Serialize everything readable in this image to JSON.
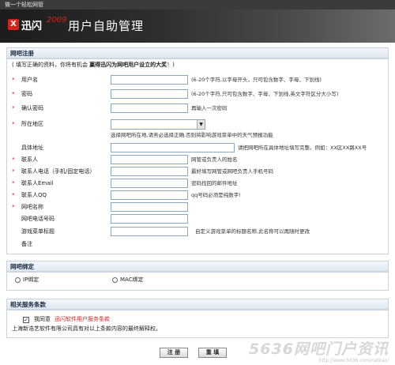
{
  "window": {
    "top_title": "做一个轻松网管"
  },
  "brand": {
    "logo_icon": "X",
    "logo_text": "迅闪",
    "logo_num": "2009",
    "page_title": "用户自助管理"
  },
  "register": {
    "header": "网吧注册",
    "notice_pre": "( 填写正确的资料，你将有机会 ",
    "notice_bold": "赢得迅闪为网吧用户设立的大奖",
    "notice_post": "！)",
    "fields": [
      {
        "required": true,
        "label": "用户名",
        "hint": "(6-20个字符,以字母开头，只可包含数字、字母、下划线)"
      },
      {
        "required": true,
        "label": "密码",
        "hint": "(6-20个字符,只可包含数字、字母、下划线,英文字符区分大小写)"
      },
      {
        "required": true,
        "label": "确认密码",
        "hint": "再输入一次密码"
      },
      {
        "required": true,
        "label": "所在地区",
        "hint": "选择网吧所在地,请务必选择正确,否则将影响游戏菜单中的天气预报功能"
      },
      {
        "required": false,
        "label": "具体地址",
        "hint": "请把网吧所在具体地址填写完整。例如：XX区XX路XX号"
      },
      {
        "required": true,
        "label": "联系人",
        "hint": "网管或负责人的姓名"
      },
      {
        "required": true,
        "label": "联系人电话（手机/固定电话）",
        "hint": "最好填写网管或网吧负责人手机号码"
      },
      {
        "required": true,
        "label": "联系人Email",
        "hint": "密码找回的邮件地址"
      },
      {
        "required": true,
        "label": "联系人QQ",
        "hint": "qq号码必须是纯数字!"
      },
      {
        "required": true,
        "label": "网吧名称",
        "hint": ""
      },
      {
        "required": false,
        "label": "网吧电话号码",
        "hint": ""
      },
      {
        "required": false,
        "label": "游戏菜单标题",
        "hint": "自定义游戏菜单的标题名称,此名称可以再随时更改"
      },
      {
        "required": false,
        "label": "备注",
        "hint": ""
      }
    ]
  },
  "bind": {
    "header": "网吧绑定",
    "option_ip": "IP绑定",
    "option_mac": "MAC绑定"
  },
  "terms": {
    "header": "相关服务条款",
    "agree_label": "我同意",
    "agree_link": "迅闪软件用户服务条款",
    "statement": "上海新浩艺软件有限公司具有对以上条款内容的最终解释权。"
  },
  "actions": {
    "submit": "注 册",
    "reset": "重 填"
  },
  "watermark": {
    "main": "5636网吧门户资讯",
    "sub": "http://www.5636.com/netbar/"
  },
  "colors": {
    "required_star": "#d12020",
    "link_red": "#cc2a2a",
    "brand_red": "#d2231c"
  }
}
